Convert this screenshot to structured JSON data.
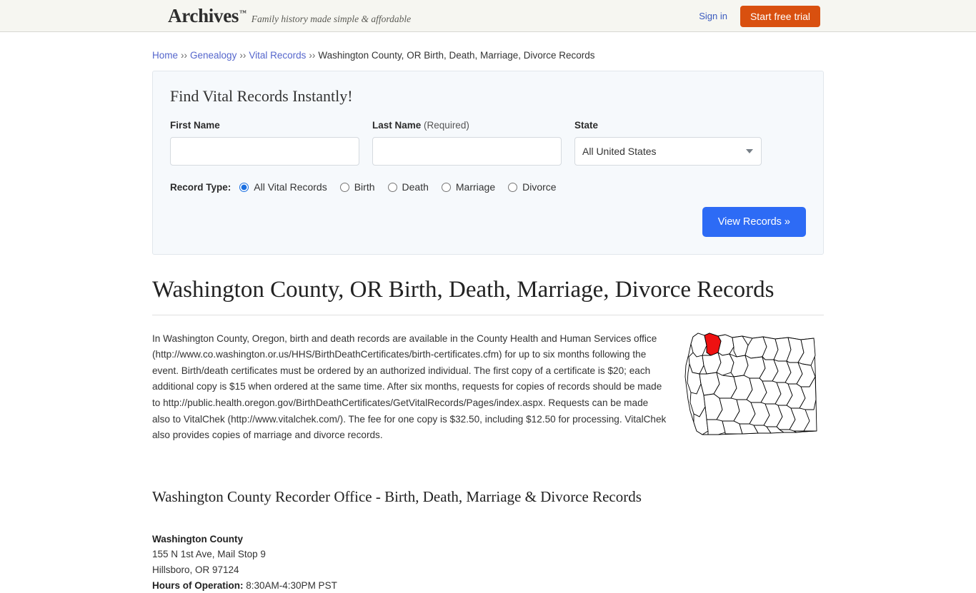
{
  "header": {
    "logo_text": "Archives",
    "logo_tm": "™",
    "tagline": "Family history made simple & affordable",
    "sign_in": "Sign in",
    "start_trial": "Start free trial",
    "trial_color": "#d9500f"
  },
  "breadcrumb": {
    "items": [
      {
        "label": "Home",
        "link": true
      },
      {
        "label": "Genealogy",
        "link": true
      },
      {
        "label": "Vital Records",
        "link": true
      },
      {
        "label": "Washington County, OR Birth, Death, Marriage, Divorce Records",
        "link": false
      }
    ],
    "separator": "››"
  },
  "search_form": {
    "title": "Find Vital Records Instantly!",
    "first_name_label": "First Name",
    "first_name_value": "",
    "first_name_placeholder": "",
    "last_name_label": "Last Name",
    "last_name_required_note": "(Required)",
    "last_name_value": "",
    "last_name_placeholder": "",
    "state_label": "State",
    "state_selected": "All United States",
    "state_options": [
      "All United States"
    ],
    "record_type_label": "Record Type:",
    "record_types": [
      {
        "label": "All Vital Records",
        "selected": true
      },
      {
        "label": "Birth",
        "selected": false
      },
      {
        "label": "Death",
        "selected": false
      },
      {
        "label": "Marriage",
        "selected": false
      },
      {
        "label": "Divorce",
        "selected": false
      }
    ],
    "submit_label": "View Records »",
    "submit_color": "#2d6bf5"
  },
  "main": {
    "heading": "Washington County, OR Birth, Death, Marriage, Divorce Records",
    "paragraph": "In Washington County, Oregon, birth and death records are available in the County Health and Human Services office (http://www.co.washington.or.us/HHS/BirthDeathCertificates/birth-certificates.cfm) for up to six months following the event. Birth/death certificates must be ordered by an authorized individual. The first copy of a certificate is $20; each additional copy is $15 when ordered at the same time. After six months, requests for copies of records should be made to http://public.health.oregon.gov/BirthDeathCertificates/GetVitalRecords/Pages/index.aspx. Requests can be made also to VitalChek (http://www.vitalchek.com/). The fee for one copy is $32.50, including $12.50 for processing. VitalChek also provides copies of marriage and divorce records.",
    "map_alt": "Map of Oregon highlighting Washington County",
    "map_highlight_color": "#ee1111",
    "section_heading": "Washington County Recorder Office - Birth, Death, Marriage & Divorce Records",
    "address": {
      "name": "Washington County",
      "street": "155 N 1st Ave, Mail Stop 9",
      "city_state_zip": "Hillsboro, OR 97124",
      "hours_label": "Hours of Operation:",
      "hours_value": "8:30AM-4:30PM PST"
    }
  }
}
